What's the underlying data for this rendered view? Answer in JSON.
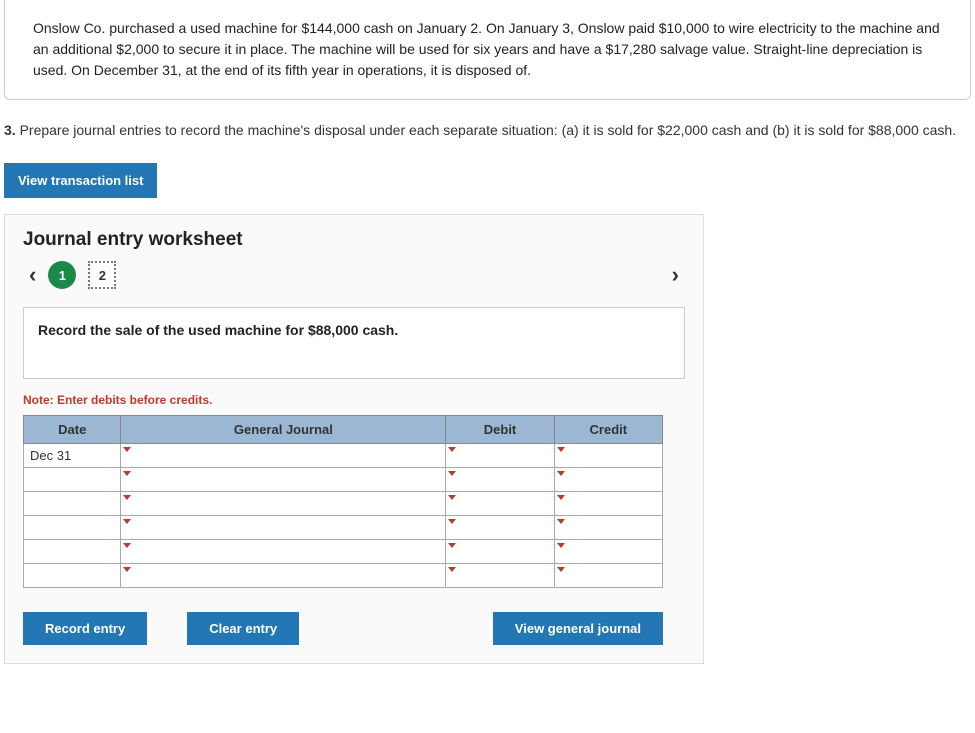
{
  "problem": {
    "text": "Onslow Co. purchased a used machine for $144,000 cash on January 2. On January 3, Onslow paid $10,000 to wire electricity to the machine and an additional $2,000 to secure it in place. The machine will be used for six years and have a $17,280 salvage value. Straight-line depreciation is used. On December 31, at the end of its fifth year in operations, it is disposed of."
  },
  "instruction": {
    "number": "3.",
    "text": "Prepare journal entries to record the machine's disposal under each separate situation: (a) it is sold for $22,000 cash and (b) it is sold for $88,000 cash."
  },
  "buttons": {
    "view_list": "View transaction list",
    "record": "Record entry",
    "clear": "Clear entry",
    "view_journal": "View general journal"
  },
  "worksheet": {
    "title": "Journal entry worksheet",
    "pages": {
      "p1": "1",
      "p2": "2"
    },
    "record_instruction": "Record the sale of the used machine for $88,000 cash.",
    "note": "Note: Enter debits before credits.",
    "headers": {
      "date": "Date",
      "gj": "General Journal",
      "debit": "Debit",
      "credit": "Credit"
    },
    "rows": [
      {
        "date": "Dec 31",
        "gj": "",
        "debit": "",
        "credit": ""
      },
      {
        "date": "",
        "gj": "",
        "debit": "",
        "credit": ""
      },
      {
        "date": "",
        "gj": "",
        "debit": "",
        "credit": ""
      },
      {
        "date": "",
        "gj": "",
        "debit": "",
        "credit": ""
      },
      {
        "date": "",
        "gj": "",
        "debit": "",
        "credit": ""
      },
      {
        "date": "",
        "gj": "",
        "debit": "",
        "credit": ""
      }
    ]
  }
}
